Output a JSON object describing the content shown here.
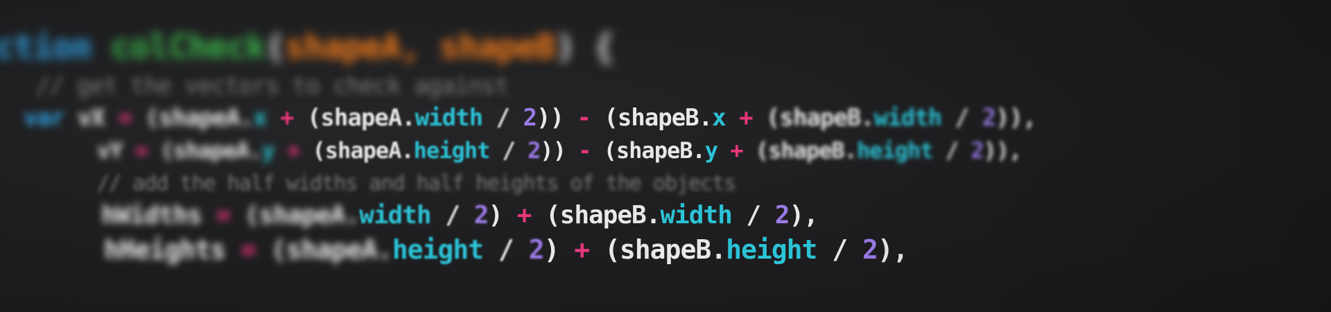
{
  "code_lines": [
    {
      "tokens": [
        {
          "text": "ction",
          "cls": "kw"
        },
        {
          "text": " ",
          "cls": "pl"
        },
        {
          "text": "colCheck",
          "cls": "fn"
        },
        {
          "text": "(",
          "cls": "pl"
        },
        {
          "text": "shapeA",
          "cls": "arg"
        },
        {
          "text": ", ",
          "cls": "arg"
        },
        {
          "text": "shapeB",
          "cls": "arg"
        },
        {
          "text": ") {",
          "cls": "pl"
        }
      ]
    },
    {
      "tokens": [
        {
          "text": "// get the vectors to check against",
          "cls": "cm"
        }
      ]
    },
    {
      "tokens": [
        {
          "text": "var",
          "cls": "kw"
        },
        {
          "text": " vX ",
          "cls": "pl"
        },
        {
          "text": "=",
          "cls": "op"
        },
        {
          "text": " (shapeA.",
          "cls": "pl"
        },
        {
          "text": "x",
          "cls": "prop"
        },
        {
          "text": " + ",
          "cls": "op"
        },
        {
          "text": "(shapeA.",
          "cls": "pl"
        },
        {
          "text": "width",
          "cls": "prop"
        },
        {
          "text": " / ",
          "cls": "pl"
        },
        {
          "text": "2",
          "cls": "num"
        },
        {
          "text": ")) ",
          "cls": "pl"
        },
        {
          "text": "-",
          "cls": "op"
        },
        {
          "text": " (shapeB.",
          "cls": "pl"
        },
        {
          "text": "x",
          "cls": "prop"
        },
        {
          "text": " + ",
          "cls": "op"
        },
        {
          "text": "(shapeB.",
          "cls": "pl"
        },
        {
          "text": "width",
          "cls": "prop"
        },
        {
          "text": " / ",
          "cls": "pl"
        },
        {
          "text": "2",
          "cls": "num"
        },
        {
          "text": ")),",
          "cls": "pl"
        }
      ]
    },
    {
      "tokens": [
        {
          "text": "vY ",
          "cls": "pl"
        },
        {
          "text": "=",
          "cls": "op"
        },
        {
          "text": " (shapeA.",
          "cls": "pl"
        },
        {
          "text": "y",
          "cls": "prop"
        },
        {
          "text": " + ",
          "cls": "op"
        },
        {
          "text": "(shapeA.",
          "cls": "pl"
        },
        {
          "text": "height",
          "cls": "prop"
        },
        {
          "text": " / ",
          "cls": "pl"
        },
        {
          "text": "2",
          "cls": "num"
        },
        {
          "text": ")) ",
          "cls": "pl"
        },
        {
          "text": "-",
          "cls": "op"
        },
        {
          "text": " (shapeB.",
          "cls": "pl"
        },
        {
          "text": "y",
          "cls": "prop"
        },
        {
          "text": " + ",
          "cls": "op"
        },
        {
          "text": "(shapeB.",
          "cls": "pl"
        },
        {
          "text": "height",
          "cls": "prop"
        },
        {
          "text": " / ",
          "cls": "pl"
        },
        {
          "text": "2",
          "cls": "num"
        },
        {
          "text": ")),",
          "cls": "pl"
        }
      ]
    },
    {
      "tokens": [
        {
          "text": "// add the half widths and half heights of the objects",
          "cls": "cm"
        }
      ]
    },
    {
      "tokens": [
        {
          "text": "hWidths ",
          "cls": "pl"
        },
        {
          "text": "=",
          "cls": "op"
        },
        {
          "text": " (shapeA.",
          "cls": "pl"
        },
        {
          "text": "width",
          "cls": "prop"
        },
        {
          "text": " / ",
          "cls": "pl"
        },
        {
          "text": "2",
          "cls": "num"
        },
        {
          "text": ") ",
          "cls": "pl"
        },
        {
          "text": "+",
          "cls": "op"
        },
        {
          "text": " (shapeB.",
          "cls": "pl"
        },
        {
          "text": "width",
          "cls": "prop"
        },
        {
          "text": " / ",
          "cls": "pl"
        },
        {
          "text": "2",
          "cls": "num"
        },
        {
          "text": "),",
          "cls": "pl"
        }
      ]
    },
    {
      "tokens": [
        {
          "text": "hHeights ",
          "cls": "pl"
        },
        {
          "text": "=",
          "cls": "op"
        },
        {
          "text": " (shapeA.",
          "cls": "pl"
        },
        {
          "text": "height",
          "cls": "prop"
        },
        {
          "text": " / ",
          "cls": "pl"
        },
        {
          "text": "2",
          "cls": "num"
        },
        {
          "text": ") ",
          "cls": "pl"
        },
        {
          "text": "+",
          "cls": "op"
        },
        {
          "text": " (shapeB.",
          "cls": "pl"
        },
        {
          "text": "height",
          "cls": "prop"
        },
        {
          "text": " / ",
          "cls": "pl"
        },
        {
          "text": "2",
          "cls": "num"
        },
        {
          "text": "),",
          "cls": "pl"
        }
      ]
    }
  ]
}
